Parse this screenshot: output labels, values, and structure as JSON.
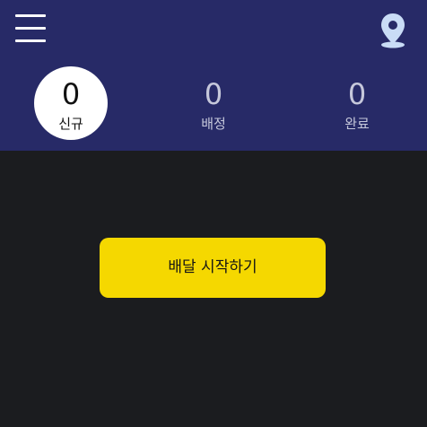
{
  "header": {
    "menu_icon": "hamburger-menu-icon",
    "location_icon": "map-pin-icon",
    "accent_color": "#272a67"
  },
  "counters": [
    {
      "count": "0",
      "label": "신규",
      "active": true
    },
    {
      "count": "0",
      "label": "배정",
      "active": false
    },
    {
      "count": "0",
      "label": "완료",
      "active": false
    }
  ],
  "main": {
    "start_button_label": "배달 시작하기",
    "start_button_color": "#f5d800",
    "background_color": "#1b1c1f"
  }
}
